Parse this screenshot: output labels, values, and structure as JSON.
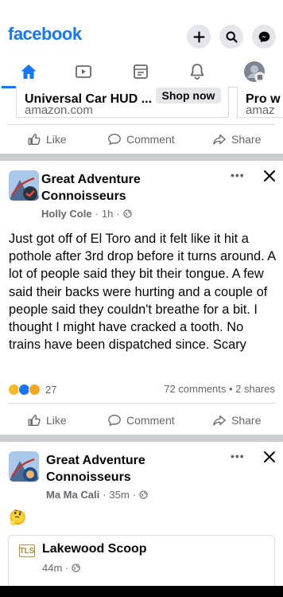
{
  "header": {
    "logo": "facebook",
    "buttons": [
      "plus-icon",
      "search-icon",
      "messenger-icon"
    ]
  },
  "nav": {
    "tabs": [
      "home-icon",
      "watch-icon",
      "marketplace-icon",
      "notifications-icon",
      "menu-profile-icon"
    ],
    "active": 0
  },
  "ad": {
    "card1_title": "Universal Car HUD ...",
    "card1_domain": "amazon.com",
    "shop_label": "Shop now",
    "card2_title": "Pro w",
    "card2_domain": "amaz"
  },
  "actions": {
    "like": "Like",
    "comment": "Comment",
    "share": "Share"
  },
  "post1": {
    "group": "Great Adventure Connoisseurs",
    "group_line1": "Great Adventure",
    "group_line2": "Connoisseurs",
    "author": "Holly Cole",
    "time": "1h",
    "more": "•••",
    "text": "Just got off of El Toro and it felt like it hit a pothole after 3rd drop before it turns around. A lot of people said they bit their tongue. A few said their backs were hurting and a couple of people said they couldn't breathe for a bit. I thought I might have cracked a tooth. No trains have been dispatched since. Scary",
    "reaction_count": "27",
    "counts": "72 comments • 2 shares"
  },
  "post2": {
    "group_line1": "Great Adventure",
    "group_line2": "Connoisseurs",
    "author": "Ma Ma Cali",
    "time": "35m",
    "more": "•••",
    "emoji": "🤔",
    "shared": {
      "logo": "TLS",
      "name": "Lakewood Scoop",
      "time": "44m"
    }
  },
  "colors": {
    "brand": "#1877f2",
    "secondary_text": "#65676b",
    "divider": "#c9ccd1"
  }
}
